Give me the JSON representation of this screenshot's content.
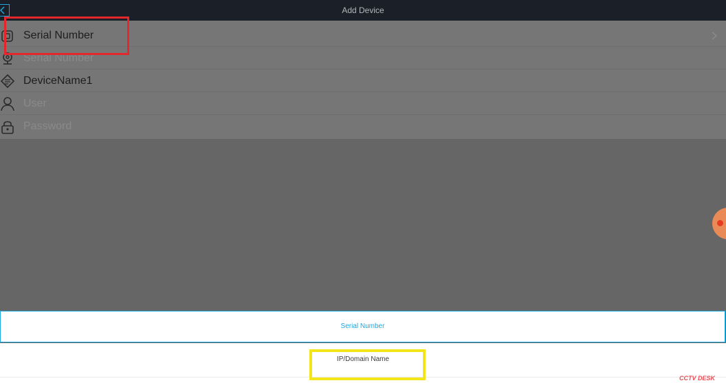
{
  "header": {
    "title": "Add Device",
    "back_icon": "back-chevron-icon"
  },
  "form": {
    "rows": [
      {
        "icon": "device-type-icon",
        "text": "Serial Number",
        "kind": "value"
      },
      {
        "icon": "serial-number-icon",
        "text": "Serial Number",
        "kind": "placeholder"
      },
      {
        "icon": "device-name-icon",
        "text": "DeviceName1",
        "kind": "value"
      },
      {
        "icon": "user-icon",
        "text": "User",
        "kind": "placeholder"
      },
      {
        "icon": "lock-icon",
        "text": "Password",
        "kind": "placeholder"
      }
    ]
  },
  "sheet": {
    "options": [
      {
        "label": "Serial Number",
        "selected": true
      },
      {
        "label": "IP/Domain Name",
        "selected": false
      }
    ]
  },
  "watermark": "CCTV DESK",
  "colors": {
    "accent": "#1ba7e0",
    "header_bg": "#1b2028",
    "highlight_red": "#e5262b",
    "highlight_yellow": "#f2e61b",
    "float_button": "#e98a57"
  }
}
